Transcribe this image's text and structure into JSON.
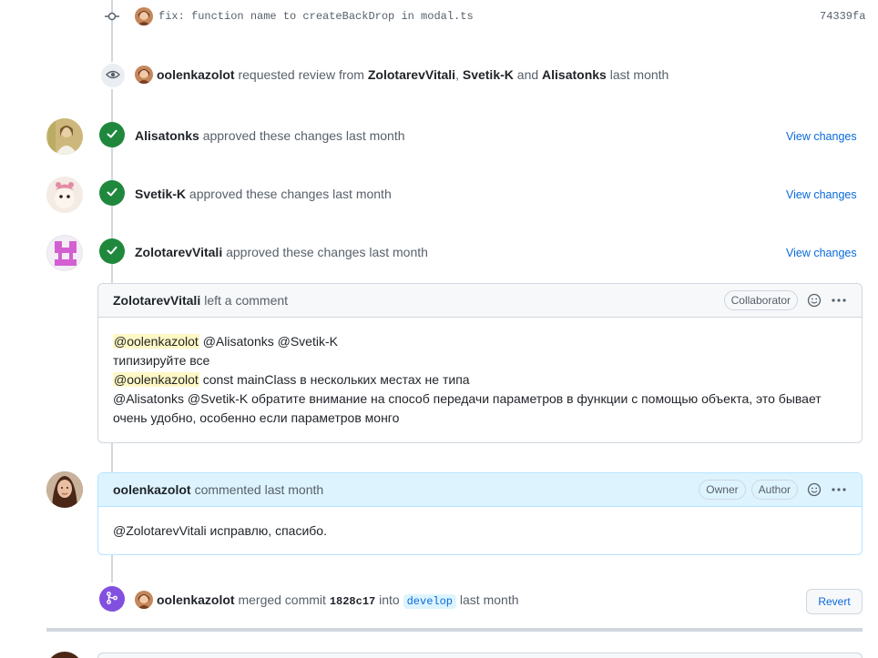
{
  "commit": {
    "message": "fix: function name to createBackDrop in modal.ts",
    "sha": "74339fa"
  },
  "review_request": {
    "actor": "oolenkazolot",
    "text_before": "requested review from",
    "reviewer1": "ZolotarevVitali",
    "sep1": ",",
    "reviewer2": "Svetik-K",
    "sep2": "and",
    "reviewer3": "Alisatonks",
    "time": "last month"
  },
  "approvals": [
    {
      "user": "Alisatonks",
      "text": "approved these changes last month",
      "link": "View changes"
    },
    {
      "user": "Svetik-K",
      "text": "approved these changes last month",
      "link": "View changes"
    },
    {
      "user": "ZolotarevVitali",
      "text": "approved these changes last month",
      "link": "View changes"
    }
  ],
  "comment1": {
    "user": "ZolotarevVitali",
    "action": "left a comment",
    "badge": "Collaborator",
    "line1_mention": "@oolenkazolot",
    "line1_rest": "@Alisatonks @Svetik-K",
    "line2": "типизируйте все",
    "line3_mention": "@oolenkazolot",
    "line3_rest": "const mainClass  в нескольких местах не типа",
    "line4": "@Alisatonks @Svetik-K обратите внимание на способ передачи параметров в функции с помощью объекта, это бывает",
    "line5": "очень удобно, особенно если параметров монго"
  },
  "comment2": {
    "user": "oolenkazolot",
    "action": "commented last month",
    "badge_owner": "Owner",
    "badge_author": "Author",
    "body": "@ZolotarevVitali исправлю, спасибо."
  },
  "merge": {
    "actor": "oolenkazolot",
    "text1": "merged commit",
    "sha": "1828c17",
    "text2": "into",
    "branch": "develop",
    "time": "last month",
    "revert": "Revert"
  },
  "colors": {
    "green": "#1f883d",
    "purple": "#8250df",
    "link": "#0969da",
    "mention_bg": "#fff8c5"
  }
}
